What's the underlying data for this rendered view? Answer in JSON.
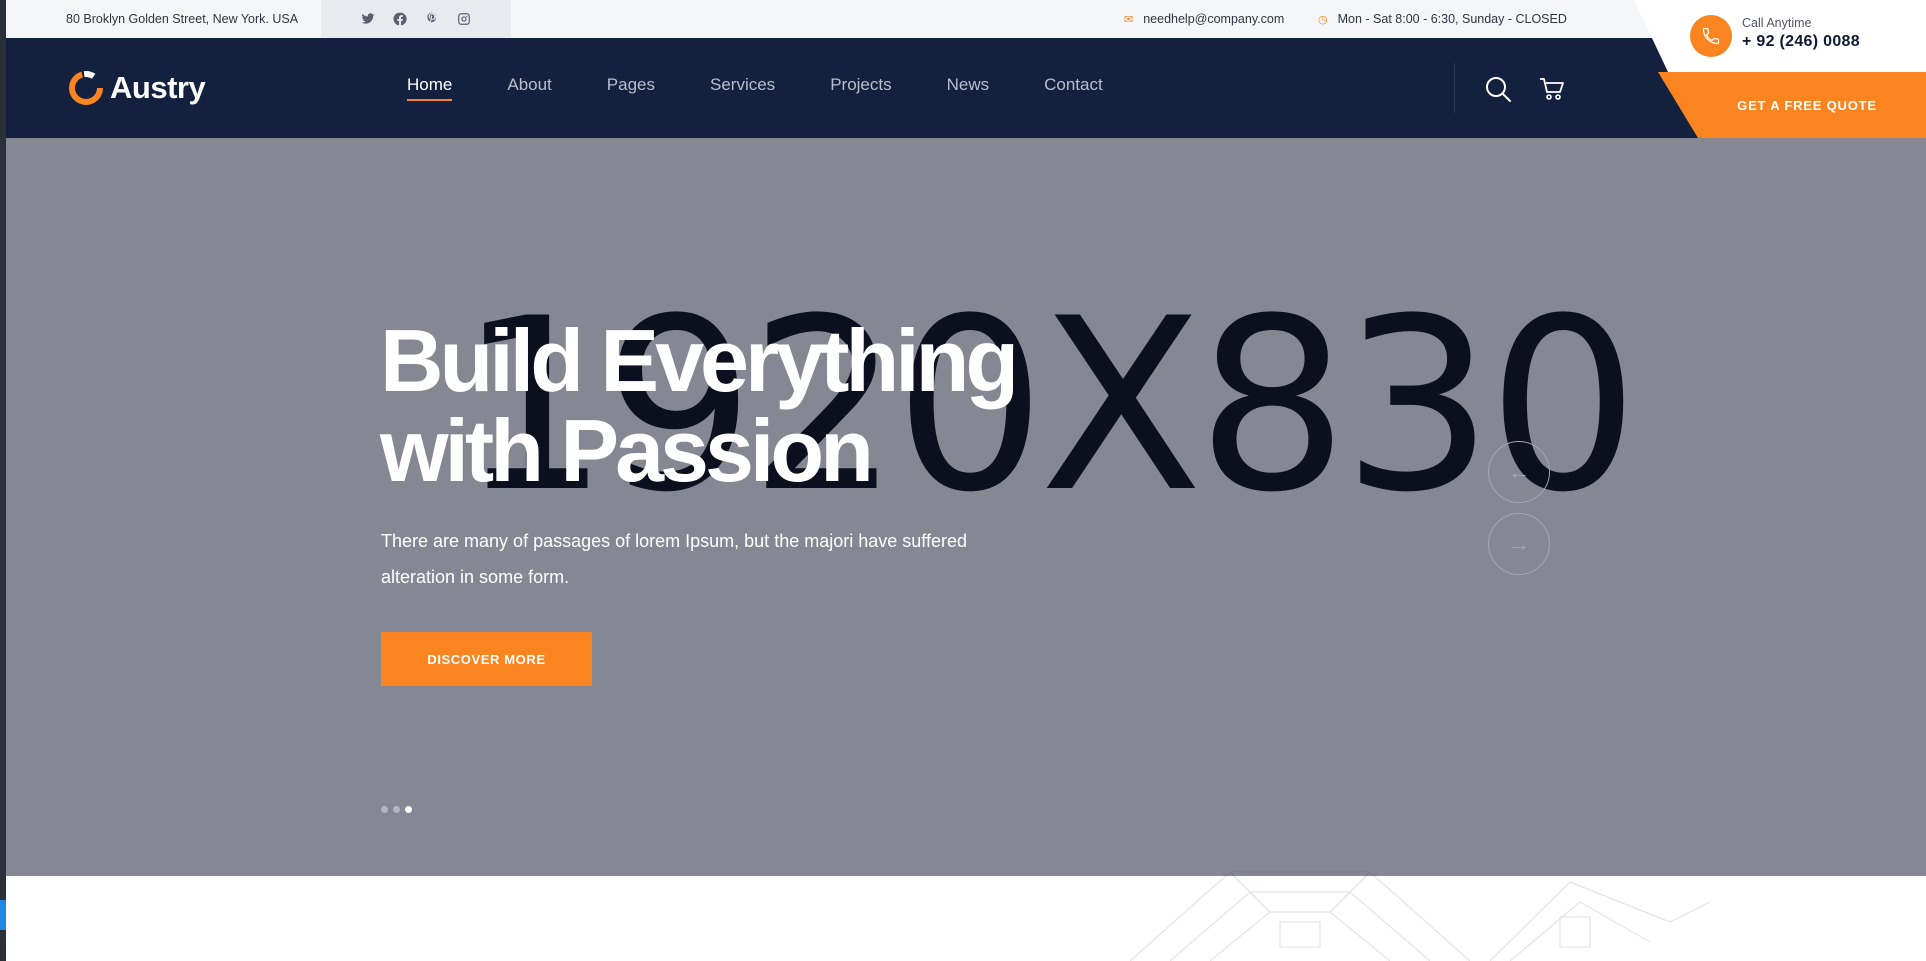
{
  "topbar": {
    "address": "80 Broklyn Golden Street, New York. USA",
    "social": [
      "twitter-icon",
      "facebook-icon",
      "pinterest-icon",
      "instagram-icon"
    ],
    "email": "needhelp@company.com",
    "hours": "Mon - Sat 8:00 - 6:30, Sunday - CLOSED"
  },
  "header": {
    "logo_text": "Austry",
    "nav": [
      {
        "label": "Home",
        "active": true
      },
      {
        "label": "About",
        "active": false
      },
      {
        "label": "Pages",
        "active": false
      },
      {
        "label": "Services",
        "active": false
      },
      {
        "label": "Projects",
        "active": false
      },
      {
        "label": "News",
        "active": false
      },
      {
        "label": "Contact",
        "active": false
      }
    ],
    "call_label": "Call Anytime",
    "call_number": "+ 92 (246) 0088",
    "quote_label": "GET A FREE QUOTE"
  },
  "hero": {
    "placeholder": "1920X830",
    "title_line1": "Build Everything",
    "title_line2": "with Passion",
    "subtitle_line1": "There are many of passages of lorem Ipsum, but the majori have suffered",
    "subtitle_line2": "alteration in some form.",
    "button": "DISCOVER MORE",
    "arrow_prev": "←",
    "arrow_next": "→",
    "slide_count": 3,
    "active_slide": 3
  },
  "colors": {
    "accent": "#f98420",
    "navy": "#13213e",
    "hero_bg": "#858893"
  }
}
